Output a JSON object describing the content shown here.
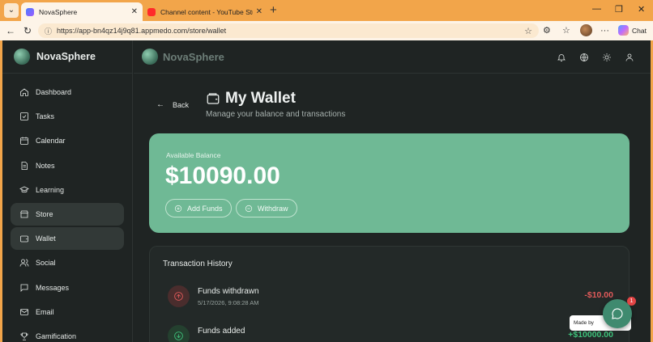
{
  "browser": {
    "tabs": [
      {
        "title": "NovaSphere",
        "active": true
      },
      {
        "title": "Channel content - YouTube Studio",
        "active": false
      }
    ],
    "url": "https://app-bn4qz14j9q81.appmedo.com/store/wallet",
    "copilot_label": "Chat",
    "accent": "#f2a54a"
  },
  "app": {
    "brand": "NovaSphere",
    "sidebar": {
      "items": [
        {
          "label": "Dashboard",
          "icon": "home-icon",
          "selected": false
        },
        {
          "label": "Tasks",
          "icon": "checkbox-icon",
          "selected": false
        },
        {
          "label": "Calendar",
          "icon": "calendar-icon",
          "selected": false
        },
        {
          "label": "Notes",
          "icon": "note-icon",
          "selected": false
        },
        {
          "label": "Learning",
          "icon": "graduation-cap-icon",
          "selected": false
        },
        {
          "label": "Store",
          "icon": "store-icon",
          "selected": true
        },
        {
          "label": "Wallet",
          "icon": "wallet-icon",
          "selected": true
        },
        {
          "label": "Social",
          "icon": "users-icon",
          "selected": false
        },
        {
          "label": "Messages",
          "icon": "message-icon",
          "selected": false
        },
        {
          "label": "Email",
          "icon": "mail-icon",
          "selected": false
        },
        {
          "label": "Gamification",
          "icon": "trophy-icon",
          "selected": false
        }
      ]
    },
    "topbar": {
      "icons": [
        "bell-icon",
        "globe-icon",
        "sun-icon",
        "user-icon"
      ]
    },
    "page": {
      "back_label": "Back",
      "title": "My Wallet",
      "subtitle": "Manage your balance and transactions",
      "balance": {
        "label": "Available Balance",
        "amount": "$10090.00",
        "add_funds_label": "Add Funds",
        "withdraw_label": "Withdraw",
        "color": "#6fb995"
      },
      "transactions": {
        "title": "Transaction History",
        "items": [
          {
            "name": "Funds withdrawn",
            "date": "5/17/2026, 9:08:28 AM",
            "amount": "-$10.00",
            "type": "withdraw",
            "color": "#e05a5a"
          },
          {
            "name": "Funds added",
            "date": "",
            "amount": "+$10000.00",
            "type": "deposit",
            "color": "#3ec07a"
          }
        ]
      }
    },
    "chat_widget": {
      "badge_count": "1",
      "made_by": "Made by"
    }
  }
}
